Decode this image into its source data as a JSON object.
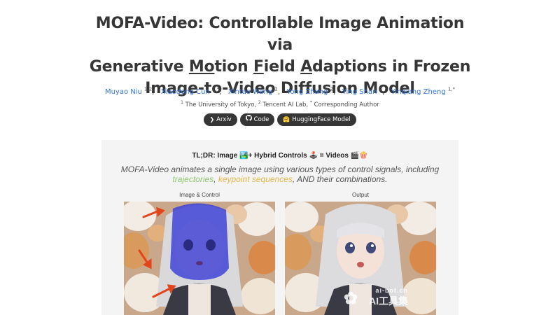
{
  "title": {
    "line1": "MOFA-Video: Controllable Image Animation via",
    "line2_pre": "Generative ",
    "line2_mo": "Mo",
    "line2_mid1": "tion ",
    "line2_f": "F",
    "line2_mid2": "ield ",
    "line2_a": "A",
    "line2_post": "daptions in Frozen",
    "line3": "Image-to-Video Diffusion Model"
  },
  "authors": [
    {
      "name": "Muyao Niu",
      "sup": "1,2"
    },
    {
      "name": "Xiaodong Cun",
      "sup": "2,*"
    },
    {
      "name": "Xintao Wang",
      "sup": "2"
    },
    {
      "name": "Yong Zhang",
      "sup": "2"
    },
    {
      "name": "Ying Shan",
      "sup": "2"
    },
    {
      "name": "Yinqiang Zheng",
      "sup": "1,*"
    }
  ],
  "affiliations": {
    "sup1": "1",
    "a1": "The University of Tokyo,",
    "sup2": "2",
    "a2": "Tencent AI Lab,",
    "sup3": "*",
    "a3": "Corresponding Author"
  },
  "buttons": {
    "arxiv": "Arxiv",
    "code": "Code",
    "huggingface": "HuggingFace Model"
  },
  "icons": {
    "arxiv": "arxiv-chevron-icon",
    "code": "github-icon",
    "huggingface": "huggingface-emoji-icon"
  },
  "panel": {
    "tldr": "TL;DR: Image 🏞️+ Hybrid Controls 🕹️ = Videos 🎬🍿",
    "desc_pre": "MOFA-Video animates a single image using various types of control signals, including",
    "desc_traj": "trajectories",
    "desc_sep": ", ",
    "desc_kps": "keypoint sequences",
    "desc_post": ", AND their combinations.",
    "label_left": "Image & Control",
    "label_right": "Output"
  },
  "watermark": {
    "small": "ai-bot.cn",
    "big": "AI工具集"
  },
  "colors": {
    "title": "#363636",
    "link": "#3273dc",
    "button_bg": "#363636",
    "panel_bg": "#f4f4f4",
    "trajectories": "#8fc971",
    "keypoints": "#e6b84c"
  }
}
